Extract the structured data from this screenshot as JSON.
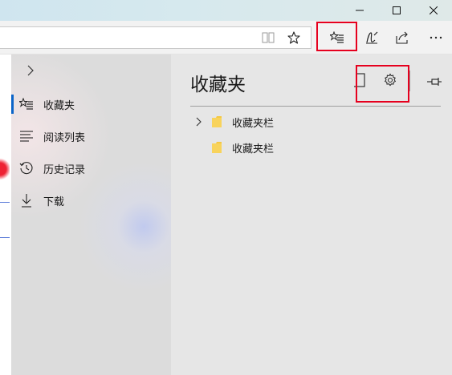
{
  "window": {
    "controls": {
      "minimize": "minimize-icon",
      "maximize": "maximize-icon",
      "close": "close-icon"
    }
  },
  "toolbar": {
    "icons": [
      "reading-view-icon",
      "favorite-star-icon",
      "hub-icon",
      "web-note-icon",
      "share-icon",
      "more-icon"
    ],
    "highlight_color": "#e6001e"
  },
  "hub": {
    "nav": {
      "expand_icon": "chevron-right-icon",
      "items": [
        {
          "label": "收藏夹",
          "icon": "favorites-icon",
          "active": true
        },
        {
          "label": "阅读列表",
          "icon": "reading-list-icon",
          "active": false
        },
        {
          "label": "历史记录",
          "icon": "history-icon",
          "active": false
        },
        {
          "label": "下载",
          "icon": "download-icon",
          "active": false
        }
      ]
    },
    "content": {
      "title": "收藏夹",
      "icons": [
        "add-to-favorites-icon",
        "settings-gear-icon",
        "pin-icon"
      ],
      "folders": [
        {
          "label": "收藏夹栏",
          "expandable": true
        },
        {
          "label": "收藏夹栏",
          "expandable": false
        }
      ]
    }
  },
  "colors": {
    "accent": "#0a64c8",
    "folder": "#f5c842",
    "annotation": "#e6001e"
  }
}
